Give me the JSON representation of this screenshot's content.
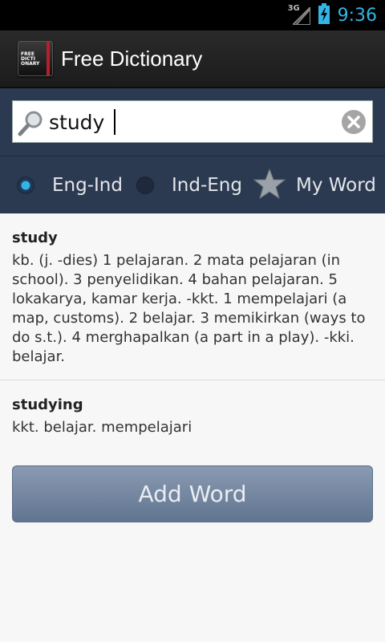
{
  "status_bar": {
    "network": "3G",
    "time": "9:36"
  },
  "app": {
    "title": "Free Dictionary",
    "icon_text": "FREE DICTI ONARY"
  },
  "search": {
    "value": "study",
    "placeholder": ""
  },
  "modes": [
    {
      "label": "Eng-Ind",
      "selected": true
    },
    {
      "label": "Ind-Eng",
      "selected": false
    },
    {
      "label": "My Word",
      "selected": false
    }
  ],
  "results": [
    {
      "word": "study",
      "definition": "kb. (j. -dies) 1 pelajaran. 2 mata pelajaran (in school). 3 penyelidikan. 4 bahan pelajaran. 5 lokakarya, kamar kerja. -kkt. 1 mempelajari (a map, customs). 2 belajar. 3 memikirkan (ways to do s.t.). 4 merghapalkan (a part in a play). -kki. belajar."
    },
    {
      "word": "studying",
      "definition": "kkt. belajar. mempelajari"
    }
  ],
  "add_word_label": "Add Word",
  "colors": {
    "accent": "#33b5e5",
    "panel": "#2b3a51",
    "button": "#7488a4"
  }
}
